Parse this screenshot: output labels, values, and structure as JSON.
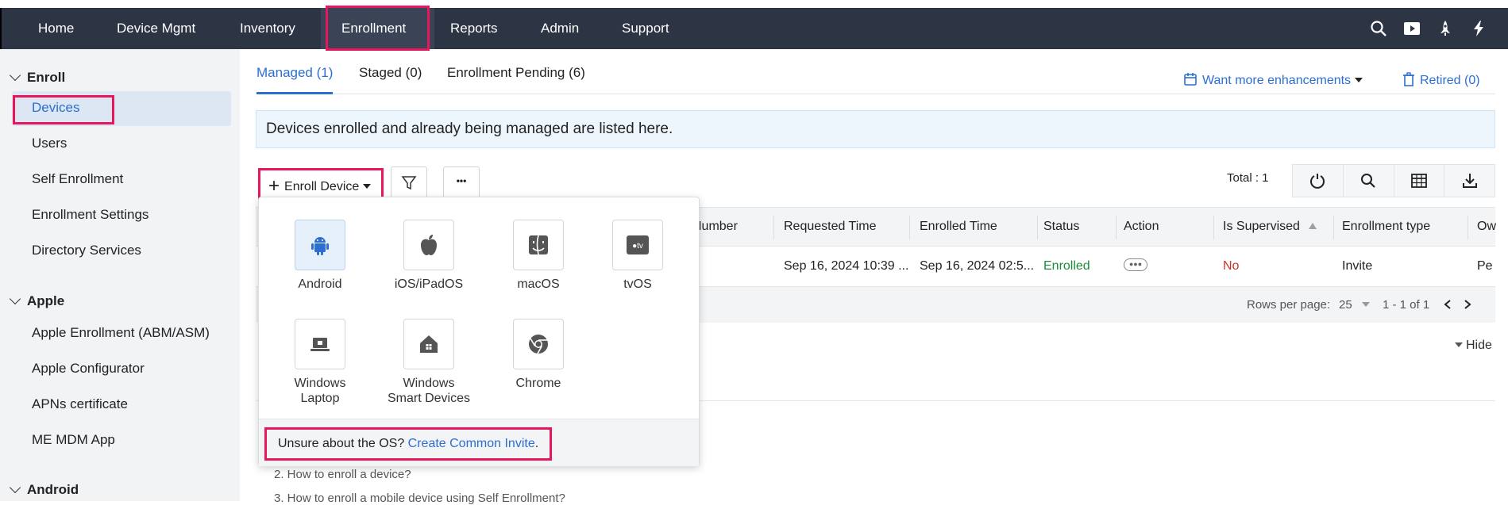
{
  "nav": {
    "items": [
      "Home",
      "Device Mgmt",
      "Inventory",
      "Enrollment",
      "Reports",
      "Admin",
      "Support"
    ],
    "active": "Enrollment",
    "icons": [
      "search-icon",
      "video-icon",
      "rocket-icon",
      "lightning-icon"
    ]
  },
  "sidebar": {
    "sections": [
      {
        "title": "Enroll",
        "items": [
          "Devices",
          "Users",
          "Self Enrollment",
          "Enrollment Settings",
          "Directory Services"
        ]
      },
      {
        "title": "Apple",
        "items": [
          "Apple Enrollment (ABM/ASM)",
          "Apple Configurator",
          "APNs certificate",
          "ME MDM App"
        ]
      },
      {
        "title": "Android",
        "items": []
      }
    ],
    "active_item": "Devices"
  },
  "tabs": [
    "Managed (1)",
    "Staged (0)",
    "Enrollment Pending (6)"
  ],
  "active_tab": "Managed (1)",
  "header_links": {
    "enhancements": "Want more enhancements",
    "retired": "Retired (0)"
  },
  "info_text": "Devices enrolled and already being managed are listed here.",
  "toolbar": {
    "enroll_label": "Enroll Device",
    "more_label": "•••",
    "total": "Total : 1"
  },
  "table": {
    "columns": [
      "Number",
      "Requested Time",
      "Enrolled Time",
      "Status",
      "Action",
      "Is Supervised",
      "Enrollment type",
      "Ow"
    ],
    "row": {
      "requested": "Sep 16, 2024 10:39 ...",
      "enrolled": "Sep 16, 2024 02:5...",
      "status": "Enrolled",
      "supervised": "No",
      "enrollment_type": "Invite",
      "owner": "Pe"
    },
    "rows_per_page_label": "Rows per page:",
    "rows_per_page": "25",
    "range": "1 - 1 of 1"
  },
  "hide_label": "Hide",
  "help_items": [
    "2. How to enroll a device?",
    "3. How to enroll a mobile device using Self Enrollment?"
  ],
  "dropdown": {
    "os_options": [
      {
        "label": "Android",
        "icon": "android-icon"
      },
      {
        "label": "iOS/iPadOS",
        "icon": "apple-icon"
      },
      {
        "label": "macOS",
        "icon": "finder-icon"
      },
      {
        "label": "tvOS",
        "icon": "appletv-icon"
      },
      {
        "label": "Windows\nLaptop",
        "icon": "laptop-icon"
      },
      {
        "label": "Windows\nSmart Devices",
        "icon": "windows-home-icon"
      },
      {
        "label": "Chrome",
        "icon": "chrome-icon"
      }
    ],
    "selected": "Android",
    "footer_text": "Unsure about the OS? ",
    "footer_link": "Create Common Invite",
    "footer_end": "."
  },
  "colors": {
    "nav_bg": "#2d3444",
    "accent": "#2c6fd1",
    "highlight": "#e8175d",
    "enrolled": "#1e8a3c",
    "no": "#d0312d"
  }
}
